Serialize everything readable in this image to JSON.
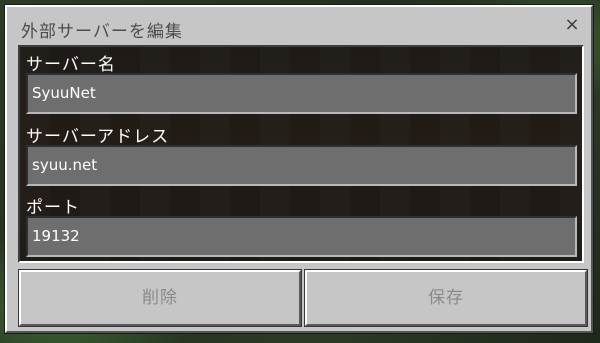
{
  "dialog": {
    "title": "外部サーバーを編集",
    "close_label": "×"
  },
  "fields": {
    "server_name": {
      "label": "サーバー名",
      "value": "SyuuNet"
    },
    "server_address": {
      "label": "サーバーアドレス",
      "value": "syuu.net"
    },
    "port": {
      "label": "ポート",
      "value": "19132"
    }
  },
  "buttons": {
    "delete_label": "削除",
    "save_label": "保存"
  }
}
